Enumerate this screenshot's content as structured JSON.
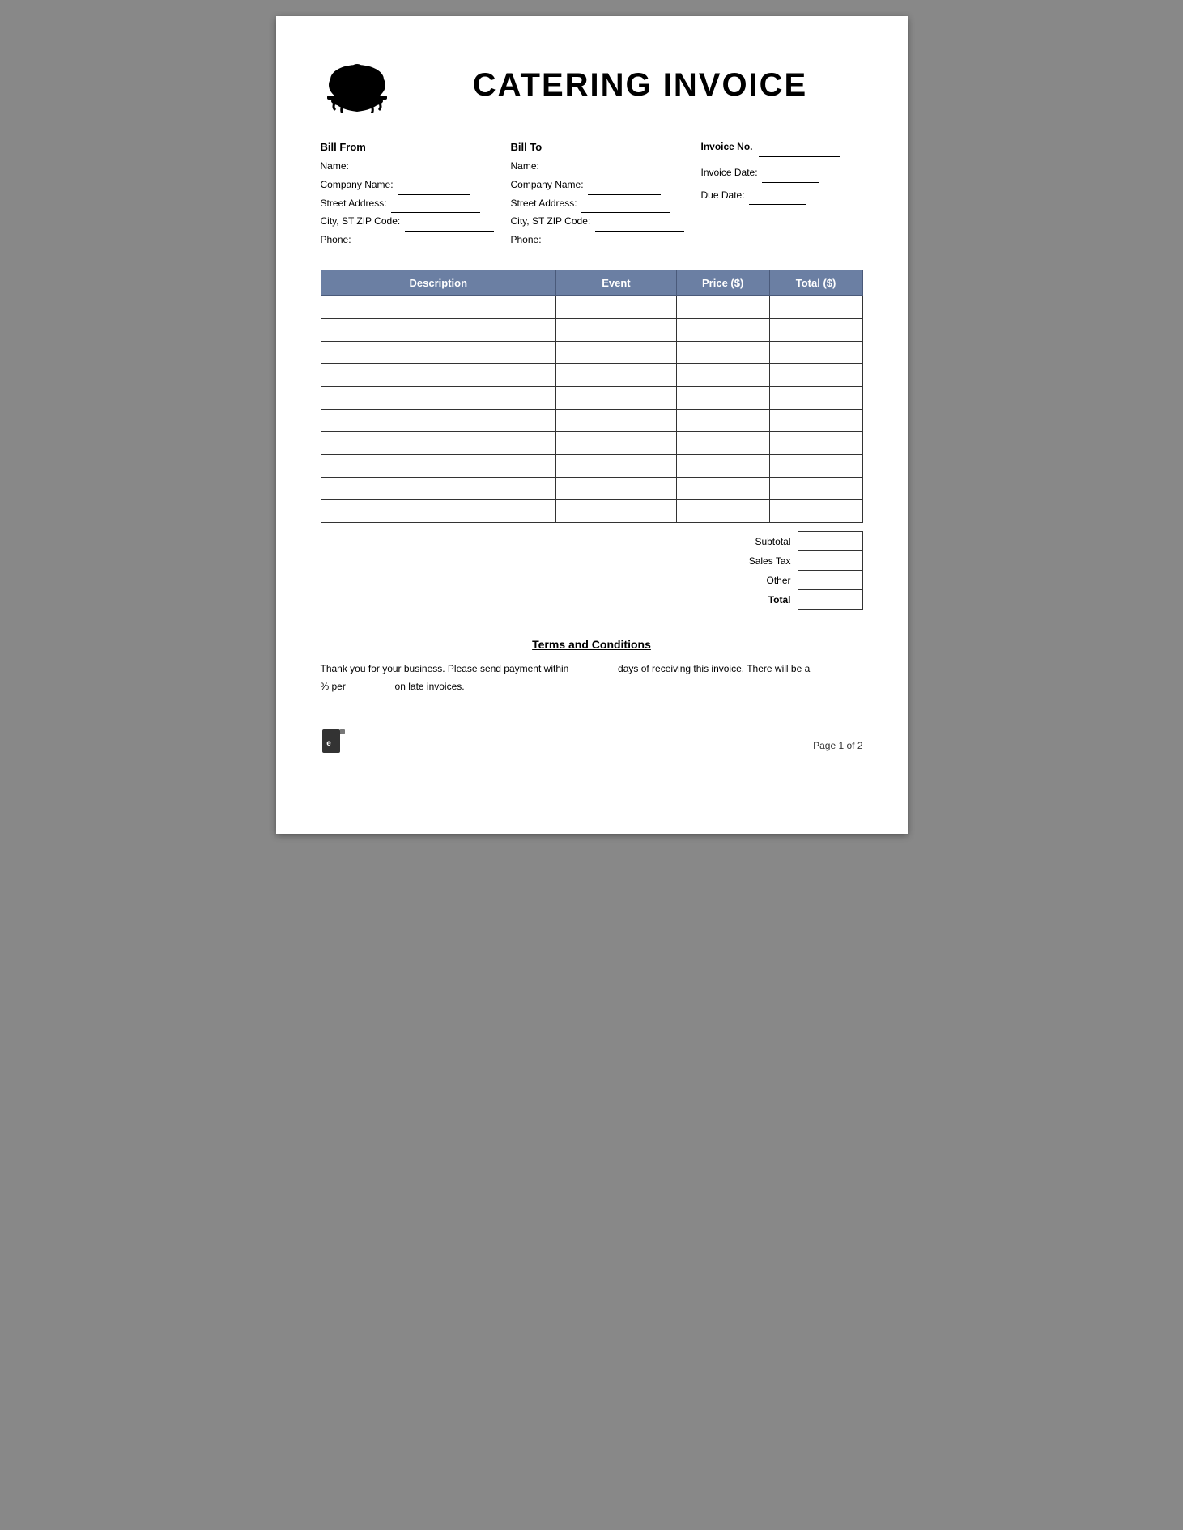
{
  "header": {
    "title": "CATERING INVOICE"
  },
  "bill_from": {
    "label": "Bill From",
    "fields": [
      {
        "name": "Name:",
        "value": ""
      },
      {
        "name": "Company Name:",
        "value": ""
      },
      {
        "name": "Street Address:",
        "value": ""
      },
      {
        "name": "City, ST ZIP Code:",
        "value": ""
      },
      {
        "name": "Phone:",
        "value": ""
      }
    ]
  },
  "bill_to": {
    "label": "Bill To",
    "fields": [
      {
        "name": "Name:",
        "value": ""
      },
      {
        "name": "Company Name:",
        "value": ""
      },
      {
        "name": "Street Address:",
        "value": ""
      },
      {
        "name": "City, ST ZIP Code:",
        "value": ""
      },
      {
        "name": "Phone:",
        "value": ""
      }
    ]
  },
  "invoice_info": {
    "invoice_no_label": "Invoice No.",
    "invoice_date_label": "Invoice Date:",
    "due_date_label": "Due Date:"
  },
  "table": {
    "headers": [
      "Description",
      "Event",
      "Price ($)",
      "Total ($)"
    ],
    "rows": 10
  },
  "summary": {
    "subtotal_label": "Subtotal",
    "sales_tax_label": "Sales Tax",
    "other_label": "Other",
    "total_label": "Total"
  },
  "terms": {
    "title": "Terms and Conditions",
    "text_part1": "Thank you for your business. Please send payment within",
    "text_part2": "days of receiving this invoice. There will be a",
    "text_part3": "% per",
    "text_part4": "on late invoices."
  },
  "footer": {
    "page_label": "Page 1 of 2"
  }
}
